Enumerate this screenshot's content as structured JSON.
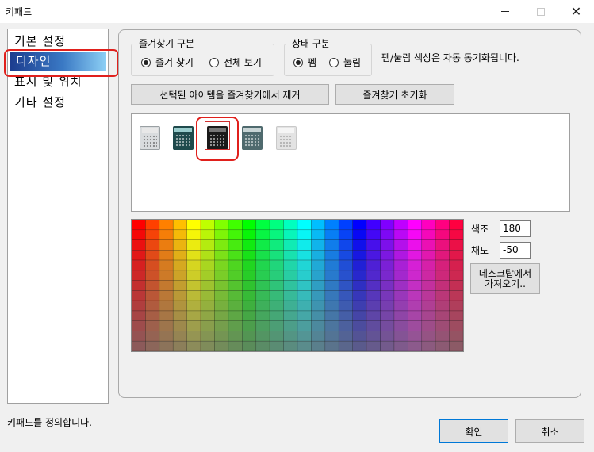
{
  "window": {
    "title": "키패드"
  },
  "sidebar": {
    "items": [
      {
        "label": "기본 설정"
      },
      {
        "label": "디자인"
      },
      {
        "label": "표시 및 위치"
      },
      {
        "label": "기타 설정"
      }
    ],
    "selected_index": 1
  },
  "design": {
    "favorites_group": {
      "label": "즐겨찾기 구분",
      "options": [
        "즐겨 찾기",
        "전체 보기"
      ],
      "selected": "즐겨 찾기"
    },
    "state_group": {
      "label": "상태 구분",
      "options": [
        "펨",
        "눌림"
      ],
      "selected": "펨"
    },
    "sync_note": "펨/눌림 색상은 자동 동기화됩니다.",
    "remove_button": "선택된 아이템을 즐겨찾기에서 제거",
    "reset_button": "즐겨찾기 초기화",
    "keypad_styles": [
      {
        "name": "light-gray",
        "color": "#d9dcde",
        "selected": false
      },
      {
        "name": "dark-teal",
        "color": "#1f4a4c",
        "selected": false
      },
      {
        "name": "black",
        "color": "#1a1a1a",
        "selected": true
      },
      {
        "name": "slate-teal",
        "color": "#4f6a6e",
        "selected": false
      },
      {
        "name": "pale-gray",
        "color": "#e3e3e3",
        "selected": false
      }
    ],
    "hue_label": "색조",
    "hue_value": "180",
    "saturation_label": "채도",
    "saturation_value": "-50",
    "desktop_button": "데스크탑에서 가져오기.."
  },
  "palette": {
    "columns": 24,
    "rows": 13
  },
  "status": {
    "text": "키패드를 정의합니다."
  },
  "buttons": {
    "ok": "확인",
    "cancel": "취소"
  }
}
